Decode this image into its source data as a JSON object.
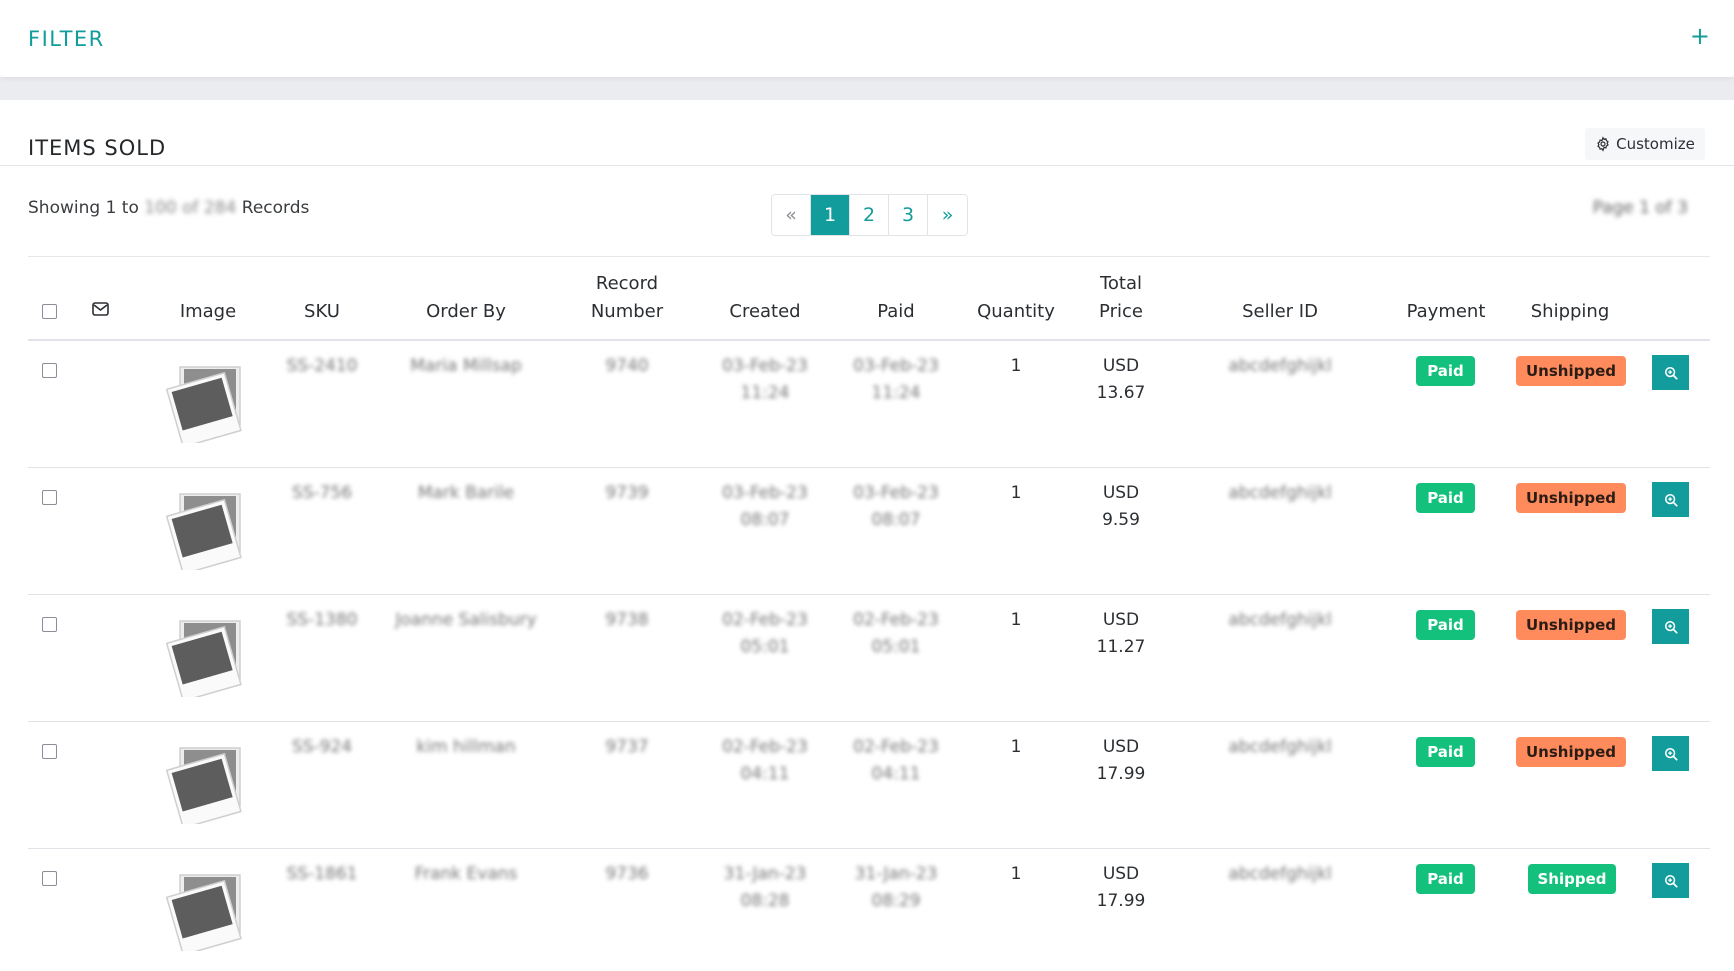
{
  "filter": {
    "title": "FILTER",
    "toggle_icon": "plus-icon",
    "toggle_label": "+"
  },
  "items_sold": {
    "title": "ITEMS SOLD",
    "customize_label": "Customize",
    "customize_icon": "gear-icon",
    "showing_prefix": "Showing 1 to",
    "showing_range": "100 of 284",
    "showing_suffix": "Records",
    "page_indicator": "Page 1 of 3",
    "pagination": {
      "prev": "«",
      "pages": [
        "1",
        "2",
        "3"
      ],
      "active_page": "1",
      "next": "»"
    }
  },
  "table": {
    "header_icon": "envelope-icon",
    "columns": {
      "image": "Image",
      "sku": "SKU",
      "order_by": "Order By",
      "record_number_1": "Record",
      "record_number_2": "Number",
      "created": "Created",
      "paid": "Paid",
      "quantity": "Quantity",
      "total_price_1": "Total",
      "total_price_2": "Price",
      "seller_id": "Seller ID",
      "payment": "Payment",
      "shipping": "Shipping"
    },
    "rows": [
      {
        "sku": "SS-2410",
        "order_by": "Maria Millsap",
        "record_number": "9740",
        "created_date": "03-Feb-23",
        "created_time": "11:24",
        "paid_date": "03-Feb-23",
        "paid_time": "11:24",
        "quantity": "1",
        "currency": "USD",
        "amount": "13.67",
        "seller_id": "abcdefghijkl",
        "payment": "Paid",
        "shipping": "Unshipped"
      },
      {
        "sku": "SS-756",
        "order_by": "Mark Barile",
        "record_number": "9739",
        "created_date": "03-Feb-23",
        "created_time": "08:07",
        "paid_date": "03-Feb-23",
        "paid_time": "08:07",
        "quantity": "1",
        "currency": "USD",
        "amount": "9.59",
        "seller_id": "abcdefghijkl",
        "payment": "Paid",
        "shipping": "Unshipped"
      },
      {
        "sku": "SS-1380",
        "order_by": "Joanne Salisbury",
        "record_number": "9738",
        "created_date": "02-Feb-23",
        "created_time": "05:01",
        "paid_date": "02-Feb-23",
        "paid_time": "05:01",
        "quantity": "1",
        "currency": "USD",
        "amount": "11.27",
        "seller_id": "abcdefghijkl",
        "payment": "Paid",
        "shipping": "Unshipped"
      },
      {
        "sku": "SS-924",
        "order_by": "kim hillman",
        "record_number": "9737",
        "created_date": "02-Feb-23",
        "created_time": "04:11",
        "paid_date": "02-Feb-23",
        "paid_time": "04:11",
        "quantity": "1",
        "currency": "USD",
        "amount": "17.99",
        "seller_id": "abcdefghijkl",
        "payment": "Paid",
        "shipping": "Unshipped"
      },
      {
        "sku": "SS-1861",
        "order_by": "Frank Evans",
        "record_number": "9736",
        "created_date": "31-Jan-23",
        "created_time": "08:28",
        "paid_date": "31-Jan-23",
        "paid_time": "08:29",
        "quantity": "1",
        "currency": "USD",
        "amount": "17.99",
        "seller_id": "abcdefghijkl",
        "payment": "Paid",
        "shipping": "Shipped"
      }
    ],
    "row_action_icon": "zoom-in-icon"
  },
  "colors": {
    "accent": "#139c9c",
    "paid_badge": "#14c17c",
    "unshipped_badge": "#ff8a5c",
    "shipped_badge": "#14c17c"
  }
}
